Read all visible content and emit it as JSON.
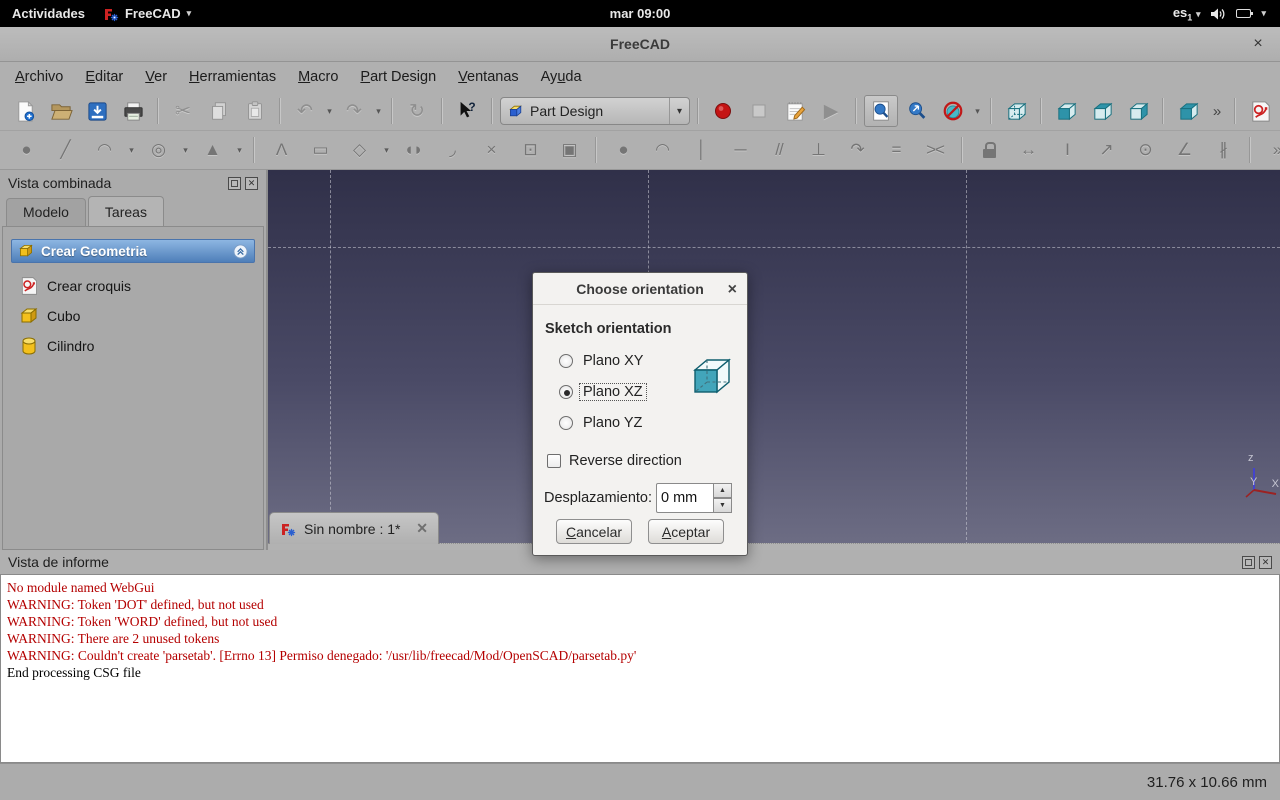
{
  "topbar": {
    "activities": "Actividades",
    "app_name": "FreeCAD",
    "clock": "mar 09:00",
    "input_source": "es",
    "input_source_sub": "1"
  },
  "window": {
    "title": "FreeCAD"
  },
  "menu_bar": {
    "items": [
      {
        "label": "Archivo",
        "u": 0
      },
      {
        "label": "Editar",
        "u": 0
      },
      {
        "label": "Ver",
        "u": 0
      },
      {
        "label": "Herramientas",
        "u": 0
      },
      {
        "label": "Macro",
        "u": 0
      },
      {
        "label": "Part Design",
        "u": 0
      },
      {
        "label": "Ventanas",
        "u": 0
      },
      {
        "label": "Ayuda",
        "u": 2
      }
    ]
  },
  "toolbar": {
    "workbench": "Part Design"
  },
  "toolbar2": {
    "items": [
      {
        "name": "sketch-point-icon",
        "glyph": "●",
        "k": "b"
      },
      {
        "name": "sketch-line-icon",
        "glyph": "╱",
        "k": "b"
      },
      {
        "name": "sketch-arc-icon",
        "glyph": "◠",
        "k": "b"
      },
      {
        "name": "dropdown-icon",
        "glyph": "▾",
        "k": "d"
      },
      {
        "name": "sketch-circle-icon",
        "glyph": "◎",
        "k": "b"
      },
      {
        "name": "dropdown-icon",
        "glyph": "▾",
        "k": "d"
      },
      {
        "name": "sketch-conic-icon",
        "glyph": "▲",
        "k": "b"
      },
      {
        "name": "dropdown-icon",
        "glyph": "▾",
        "k": "d"
      },
      {
        "k": "sep"
      },
      {
        "name": "sketch-polyline-icon",
        "glyph": "Λ",
        "k": "b"
      },
      {
        "name": "sketch-rectangle-icon",
        "glyph": "▭",
        "k": "b"
      },
      {
        "name": "sketch-polygon-icon",
        "glyph": "◇",
        "k": "b"
      },
      {
        "name": "dropdown-icon",
        "glyph": "▾",
        "k": "d"
      },
      {
        "name": "sketch-slot-icon",
        "glyph": "◖◗",
        "k": "b"
      },
      {
        "name": "sketch-fillet-icon",
        "glyph": "◞",
        "k": "b"
      },
      {
        "name": "sketch-trim-icon",
        "glyph": "×",
        "k": "b"
      },
      {
        "name": "sketch-external-geometry-icon",
        "glyph": "⊡",
        "k": "b"
      },
      {
        "name": "sketch-carbon-copy-icon",
        "glyph": "▣",
        "k": "b"
      },
      {
        "k": "sep"
      },
      {
        "name": "constraint-coincident-icon",
        "glyph": "●",
        "k": "b"
      },
      {
        "name": "constraint-point-on-object-icon",
        "glyph": "◠",
        "k": "b"
      },
      {
        "name": "constraint-vertical-icon",
        "glyph": "│",
        "k": "b"
      },
      {
        "name": "constraint-horizontal-icon",
        "glyph": "─",
        "k": "b"
      },
      {
        "name": "constraint-parallel-icon",
        "glyph": "//",
        "k": "b"
      },
      {
        "name": "constraint-perpendicular-icon",
        "glyph": "⊥",
        "k": "b"
      },
      {
        "name": "constraint-tangent-icon",
        "glyph": "↷",
        "k": "b"
      },
      {
        "name": "constraint-equal-icon",
        "glyph": "=",
        "k": "b"
      },
      {
        "name": "constraint-symmetric-icon",
        "glyph": "><",
        "k": "b"
      },
      {
        "k": "sep"
      },
      {
        "name": "constraint-lock-icon",
        "k": "lock"
      },
      {
        "name": "constraint-horizontal-distance-icon",
        "glyph": "↔",
        "k": "b"
      },
      {
        "name": "constraint-vertical-distance-icon",
        "glyph": "I",
        "k": "b"
      },
      {
        "name": "constraint-distance-icon",
        "glyph": "↗",
        "k": "b"
      },
      {
        "name": "constraint-radius-icon",
        "glyph": "⊙",
        "k": "b"
      },
      {
        "name": "constraint-angle-icon",
        "glyph": "∠",
        "k": "b"
      },
      {
        "name": "constraint-snell-icon",
        "glyph": "∦",
        "k": "b"
      },
      {
        "k": "sep"
      },
      {
        "name": "toolbar-overflow-icon",
        "glyph": "»",
        "k": "b"
      },
      {
        "k": "sep"
      },
      {
        "name": "sketch-bspline-icon",
        "glyph": "∿",
        "k": "b"
      },
      {
        "name": "toolbar-overflow-icon",
        "glyph": "»",
        "k": "b"
      }
    ]
  },
  "combined_view": {
    "title": "Vista combinada",
    "tabs": [
      {
        "label": "Modelo",
        "name": "tab-modelo"
      },
      {
        "label": "Tareas",
        "name": "tab-tareas",
        "selected": true
      }
    ],
    "task_panel": {
      "group_title": "Crear Geometria",
      "items": [
        "Crear croquis",
        "Cubo",
        "Cilindro"
      ]
    }
  },
  "viewport": {
    "document_tab": "Sin nombre : 1*",
    "axis": {
      "z": "z",
      "y": "Y",
      "x": "X"
    }
  },
  "dialog": {
    "title": "Choose orientation",
    "group_label": "Sketch orientation",
    "radios": [
      {
        "label": "Plano XY",
        "name": "radio-plano-xy"
      },
      {
        "label": "Plano XZ",
        "name": "radio-plano-xz",
        "selected": true
      },
      {
        "label": "Plano YZ",
        "name": "radio-plano-yz"
      }
    ],
    "reverse_label": "Reverse direction",
    "offset_label": "Desplazamiento:",
    "offset_value": "0 mm",
    "cancel_label": "Cancelar",
    "ok_label": "Aceptar"
  },
  "report_view": {
    "title": "Vista de informe",
    "lines": [
      {
        "text": "No module named WebGui",
        "color": "#b40000"
      },
      {
        "text": "WARNING: Token 'DOT' defined, but not used",
        "color": "#b40000"
      },
      {
        "text": "WARNING: Token 'WORD' defined, but not used",
        "color": "#b40000"
      },
      {
        "text": "WARNING: There are 2 unused tokens",
        "color": "#b40000"
      },
      {
        "text": "WARNING: Couldn't create 'parsetab'. [Errno 13] Permiso denegado: '/usr/lib/freecad/Mod/OpenSCAD/parsetab.py'",
        "color": "#b40000"
      },
      {
        "text": "End processing CSG file",
        "color": "#000000"
      }
    ]
  },
  "status_bar": {
    "dimensions": "31.76 x 10.66 mm"
  },
  "colors": {
    "accent_blue": "#4f7fb9",
    "warning_red": "#b40000",
    "viewport_top": "#303049",
    "viewport_bottom": "#6e6e85",
    "teal_icon": "#2e93a9",
    "yellow_icon": "#f3c01c"
  },
  "icons": {
    "row1": [
      "new-document",
      "open-document",
      "save",
      "print",
      "cut",
      "copy",
      "paste",
      "undo",
      "redo",
      "refresh",
      "whats-this",
      "workbench-selector",
      "macro-record",
      "macro-stop",
      "macro-edit",
      "macro-play",
      "fit-all",
      "fit-selection",
      "draw-style",
      "view-axonometric",
      "view-front",
      "view-top",
      "view-right",
      "view-isometric",
      "toolbar-overflow",
      "new-sketch",
      "toolbar-overflow"
    ]
  }
}
